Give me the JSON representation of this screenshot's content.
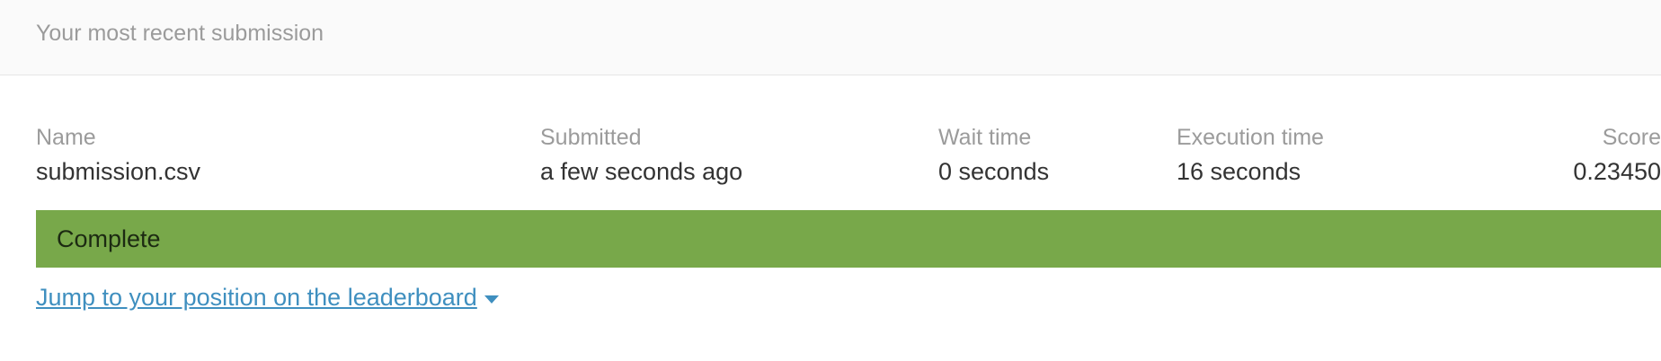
{
  "header": {
    "title": "Your most recent submission"
  },
  "submission": {
    "columns": {
      "name": {
        "label": "Name",
        "value": "submission.csv"
      },
      "submitted": {
        "label": "Submitted",
        "value": "a few seconds ago"
      },
      "wait": {
        "label": "Wait time",
        "value": "0 seconds"
      },
      "execution": {
        "label": "Execution time",
        "value": "16 seconds"
      },
      "score": {
        "label": "Score",
        "value": "0.23450"
      }
    },
    "status": {
      "text": "Complete",
      "color": "#78a84a"
    }
  },
  "links": {
    "leaderboard": "Jump to your position on the leaderboard",
    "leaderboard_icon": "caret-down-icon",
    "color": "#3f8fbf"
  }
}
